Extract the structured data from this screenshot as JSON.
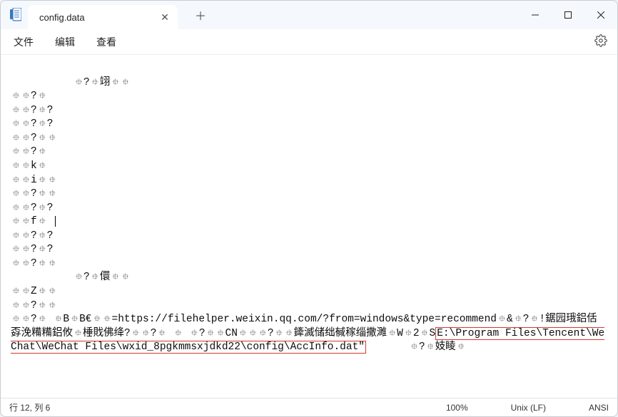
{
  "window": {
    "title": "config.data"
  },
  "menu": {
    "file": "文件",
    "edit": "编辑",
    "view": "查看"
  },
  "editor": {
    "line1_indent": true,
    "line1": "?翊",
    "lines_a": [
      "?",
      "?",
      "?",
      "?",
      "?",
      "k",
      "i",
      "?",
      "?",
      "f"
    ],
    "line_after_f_caret": true,
    "lines_b": [
      "?",
      "?",
      "?"
    ],
    "line_mid_indent": true,
    "line_mid": "?儇",
    "lines_c": [
      "Z",
      "?"
    ],
    "para_prefix": "? BB€=",
    "url": "https://filehelper.weixin.qq.com/?from=windows&type=recommend",
    "para_mid1": "&?!鋸园珴鋁佸孬浼糒糒鋁攸棰戝佛绛??  ?CN?",
    "para_mid2": "鏲滅储绌戫稼缁撒濉W2S",
    "hl_path": "E:\\Program Files\\Tencent\\WeChat\\WeChat Files\\wxid_8pgkmmsxjdkd22\\config\\AccInfo.dat\"",
    "para_tail_indent": true,
    "para_tail": "?妓睖"
  },
  "status": {
    "pos": "行 12, 列 6",
    "zoom": "100%",
    "eol": "Unix (LF)",
    "encoding": "ANSI"
  }
}
